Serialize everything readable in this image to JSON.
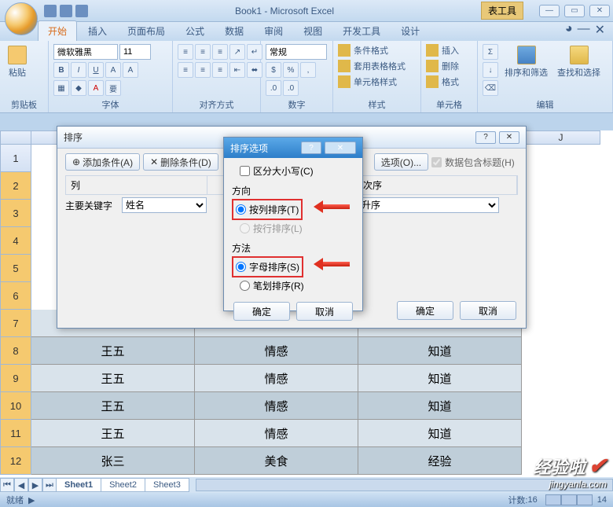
{
  "title": "Book1 - Microsoft Excel",
  "contextual_tab": "表工具",
  "tabs": [
    "开始",
    "插入",
    "页面布局",
    "公式",
    "数据",
    "审阅",
    "视图",
    "开发工具",
    "设计"
  ],
  "active_tab_index": 0,
  "ribbon": {
    "clipboard": {
      "paste": "粘贴",
      "label": "剪贴板"
    },
    "font": {
      "name": "微软雅黑",
      "size": "11",
      "label": "字体"
    },
    "alignment": {
      "label": "对齐方式"
    },
    "number": {
      "format": "常规",
      "label": "数字"
    },
    "styles": {
      "conditional": "条件格式",
      "table": "套用表格格式",
      "cell": "单元格样式",
      "label": "样式"
    },
    "cells": {
      "insert": "插入",
      "delete": "删除",
      "format": "格式",
      "label": "单元格"
    },
    "editing": {
      "sort": "排序和筛选",
      "find": "查找和选择",
      "label": "编辑"
    }
  },
  "columns": [
    "J"
  ],
  "rows": [
    "1",
    "2",
    "3",
    "4",
    "5",
    "6",
    "7",
    "8",
    "9",
    "10",
    "11",
    "12"
  ],
  "data_rows": [
    {
      "c1": "",
      "c2": "",
      "c3": ""
    },
    {
      "c1": "王五",
      "c2": "情感",
      "c3": "知道"
    },
    {
      "c1": "王五",
      "c2": "情感",
      "c3": "知道"
    },
    {
      "c1": "王五",
      "c2": "情感",
      "c3": "知道"
    },
    {
      "c1": "王五",
      "c2": "情感",
      "c3": "知道"
    },
    {
      "c1": "张三",
      "c2": "美食",
      "c3": "经验"
    }
  ],
  "sheets": [
    "Sheet1",
    "Sheet2",
    "Sheet3"
  ],
  "status": {
    "ready": "就绪",
    "count_label": "计数:",
    "count": "16",
    "zoom_label": "14"
  },
  "dlg_sort": {
    "title": "排序",
    "add": "添加条件(A)",
    "delete": "删除条件(D)",
    "options": "选项(O)...",
    "has_header": "数据包含标题(H)",
    "col_hdr": "列",
    "order_hdr": "次序",
    "primary_label": "主要关键字",
    "primary_value": "姓名",
    "order_value": "升序",
    "ok": "确定",
    "cancel": "取消"
  },
  "dlg_opt": {
    "title": "排序选项",
    "case": "区分大小写(C)",
    "direction": "方向",
    "by_col": "按列排序(T)",
    "by_row": "按行排序(L)",
    "method": "方法",
    "pinyin": "字母排序(S)",
    "stroke": "笔划排序(R)",
    "ok": "确定",
    "cancel": "取消"
  },
  "watermark": {
    "text": "经验啦",
    "url": "jingyanla.com"
  }
}
